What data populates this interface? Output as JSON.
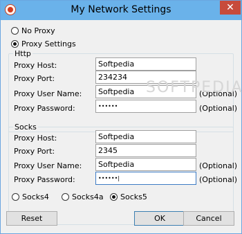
{
  "window": {
    "title": "My Network Settings",
    "close": "✕"
  },
  "mode": {
    "no_proxy": "No Proxy",
    "proxy_settings": "Proxy Settings",
    "selected": "proxy_settings"
  },
  "http": {
    "legend": "Http",
    "host": {
      "label": "Proxy Host:",
      "value": "Softpedia"
    },
    "port": {
      "label": "Proxy Port:",
      "value": "234234"
    },
    "user": {
      "label": "Proxy User Name:",
      "value": "Softpedia",
      "note": "(Optional)"
    },
    "password": {
      "label": "Proxy Password:",
      "value": "••••••",
      "note": "(Optional)"
    }
  },
  "socks": {
    "legend": "Socks",
    "host": {
      "label": "Proxy Host:",
      "value": "Softpedia"
    },
    "port": {
      "label": "Proxy Port:",
      "value": "2345"
    },
    "user": {
      "label": "Proxy User Name:",
      "value": "Softpedia",
      "note": "(Optional)"
    },
    "password": {
      "label": "Proxy Password:",
      "value": "••••••|",
      "note": "(Optional)"
    },
    "versions": [
      "Socks4",
      "Socks4a",
      "Socks5"
    ],
    "selected_version": "Socks5"
  },
  "buttons": {
    "reset": "Reset",
    "ok": "OK",
    "cancel": "Cancel"
  },
  "watermark": "SOFTPEDIA",
  "colors": {
    "titlebar": "#6ab2ea",
    "close": "#c74b3b",
    "dialog": "#f0f0f0"
  }
}
